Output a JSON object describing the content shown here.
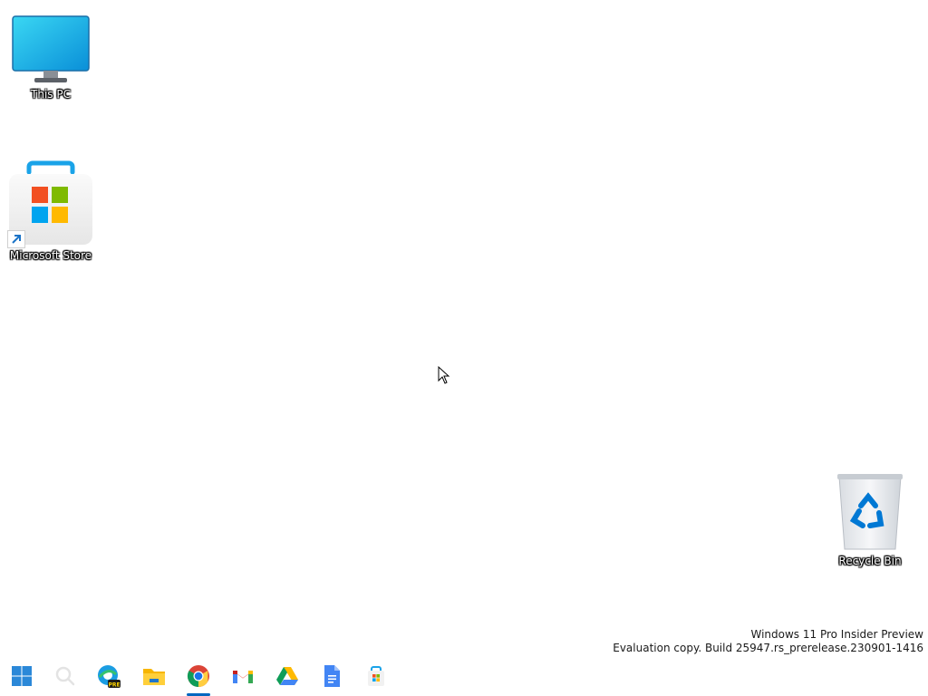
{
  "desktop": {
    "icons": [
      {
        "label": "This PC",
        "icon": "monitor-icon"
      },
      {
        "label": "Microsoft Store",
        "icon": "microsoft-store-icon",
        "shortcut": true
      },
      {
        "label": "Recycle Bin",
        "icon": "recycle-bin-icon"
      }
    ]
  },
  "watermark": {
    "line1": "Windows 11 Pro Insider Preview",
    "line2": "Evaluation copy. Build 25947.rs_prerelease.230901-1416"
  },
  "taskbar": {
    "items": [
      {
        "name": "Start",
        "icon": "windows-start-icon"
      },
      {
        "name": "Search",
        "icon": "search-icon"
      },
      {
        "name": "Microsoft Edge Preview",
        "icon": "edge-preview-icon",
        "badge": "PRE"
      },
      {
        "name": "File Explorer",
        "icon": "folder-icon"
      },
      {
        "name": "Google Chrome",
        "icon": "chrome-icon",
        "active": true
      },
      {
        "name": "Gmail",
        "icon": "gmail-icon"
      },
      {
        "name": "Google Drive",
        "icon": "google-drive-icon"
      },
      {
        "name": "Google Docs",
        "icon": "google-docs-icon"
      },
      {
        "name": "Microsoft Store",
        "icon": "microsoft-store-icon"
      }
    ]
  },
  "colors": {
    "ms_red": "#f25022",
    "ms_green": "#7fba00",
    "ms_blue": "#00a4ef",
    "ms_yellow": "#ffb900",
    "accent": "#0067c0"
  }
}
